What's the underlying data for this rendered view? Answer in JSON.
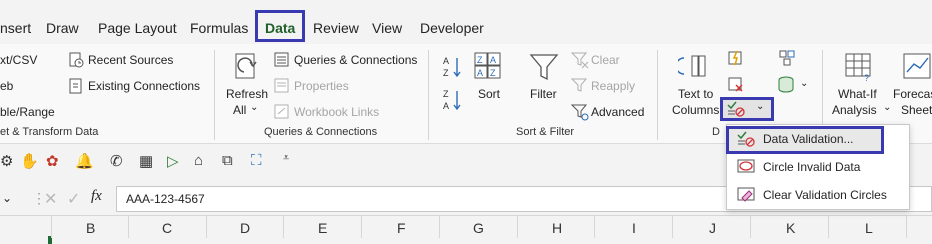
{
  "tabs": {
    "insert": "nsert",
    "draw": "Draw",
    "page_layout": "Page Layout",
    "formulas": "Formulas",
    "data": "Data",
    "review": "Review",
    "view": "View",
    "developer": "Developer"
  },
  "get_transform": {
    "text_csv": "xt/CSV",
    "web": "eb",
    "table_range": "ble/Range",
    "recent_sources": "Recent Sources",
    "existing_connections": "Existing Connections",
    "group_label": "et & Transform Data"
  },
  "queries": {
    "refresh_all_1": "Refresh",
    "refresh_all_2": "All",
    "queries_connections": "Queries & Connections",
    "properties": "Properties",
    "workbook_links": "Workbook Links",
    "group_label": "Queries & Connections"
  },
  "sort_filter": {
    "sort": "Sort",
    "filter": "Filter",
    "clear": "Clear",
    "reapply": "Reapply",
    "advanced": "Advanced",
    "group_label": "Sort & Filter",
    "az": "A Z",
    "za": "Z A",
    "za_icon": "Z A"
  },
  "data_tools": {
    "text_to_columns_1": "Text to",
    "text_to_columns_2": "Columns",
    "group_label_fragment": "D"
  },
  "forecast": {
    "what_if_1": "What-If",
    "what_if_2": "Analysis",
    "forecast_1": "Forecas",
    "forecast_2": "Sheet"
  },
  "menu": {
    "data_validation": "Data Validation...",
    "circle_invalid": "Circle Invalid Data",
    "clear_circles": "Clear Validation Circles"
  },
  "formula_bar": {
    "fx": "fx",
    "value": "AAA-123-4567"
  },
  "columns": [
    "B",
    "C",
    "D",
    "E",
    "F",
    "G",
    "H",
    "I",
    "J",
    "K",
    "L"
  ],
  "colors": {
    "accent_green": "#1f5f2a",
    "highlight_box": "#3a3ab0",
    "icon_red": "#d13438"
  }
}
